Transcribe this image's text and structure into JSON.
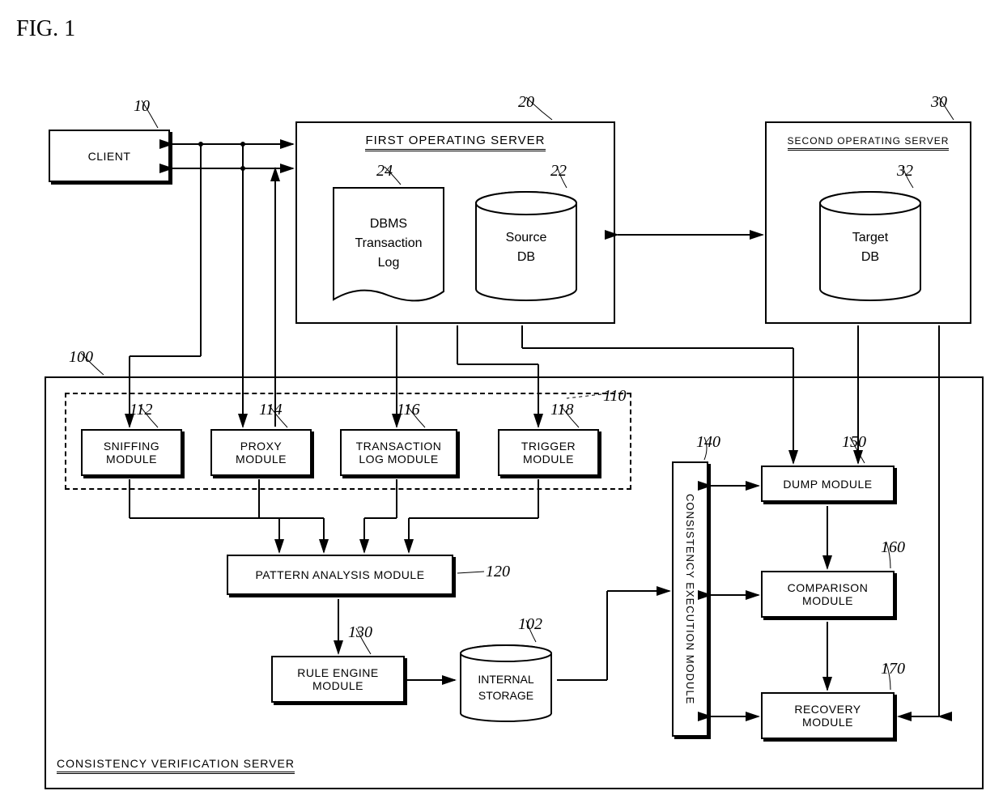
{
  "figure": "FIG. 1",
  "client": {
    "label": "CLIENT",
    "ref": "10"
  },
  "first_server": {
    "title": "FIRST OPERATING SERVER",
    "ref": "20",
    "dbms_log": {
      "label1": "DBMS",
      "label2": "Transaction",
      "label3": "Log",
      "ref": "24"
    },
    "source_db": {
      "label1": "Source",
      "label2": "DB",
      "ref": "22"
    }
  },
  "second_server": {
    "title": "SECOND OPERATING SERVER",
    "ref": "30",
    "target_db": {
      "label1": "Target",
      "label2": "DB",
      "ref": "32"
    }
  },
  "cvs": {
    "title": "CONSISTENCY VERIFICATION SERVER",
    "ref": "100",
    "group_ref": "110",
    "modules": {
      "sniffing": {
        "label1": "SNIFFING",
        "label2": "MODULE",
        "ref": "112"
      },
      "proxy": {
        "label1": "PROXY",
        "label2": "MODULE",
        "ref": "114"
      },
      "txlog": {
        "label1": "TRANSACTION",
        "label2": "LOG MODULE",
        "ref": "116"
      },
      "trigger": {
        "label1": "TRIGGER",
        "label2": "MODULE",
        "ref": "118"
      },
      "pattern": {
        "label": "PATTERN ANALYSIS MODULE",
        "ref": "120"
      },
      "rule": {
        "label1": "RULE ENGINE",
        "label2": "MODULE",
        "ref": "130"
      },
      "storage": {
        "label1": "INTERNAL",
        "label2": "STORAGE",
        "ref": "102"
      },
      "cexec": {
        "label": "CONSISTENCY EXECUTION MODULE",
        "ref": "140"
      },
      "dump": {
        "label": "DUMP MODULE",
        "ref": "150"
      },
      "compare": {
        "label1": "COMPARISON",
        "label2": "MODULE",
        "ref": "160"
      },
      "recovery": {
        "label1": "RECOVERY",
        "label2": "MODULE",
        "ref": "170"
      }
    }
  }
}
